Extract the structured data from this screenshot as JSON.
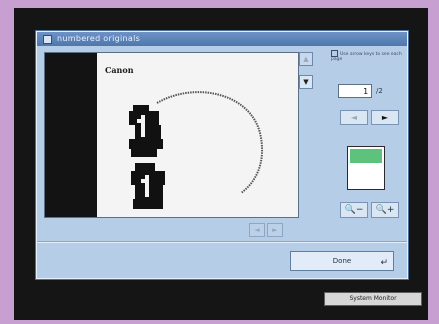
{
  "window": {
    "title": "numbered originals"
  },
  "preview": {
    "logo": "Canon"
  },
  "sidebar": {
    "hint": "Use arrow keys to see each page",
    "page_number": "1",
    "page_total": "/2",
    "prev_label": "◄",
    "next_label": "►",
    "zoom_out_label": "🔍−",
    "zoom_in_label": "🔍+"
  },
  "footer": {
    "done_label": "Done",
    "enter_icon": "↵"
  },
  "taskbar": {
    "system_monitor_label": "System Monitor"
  },
  "colors": {
    "background": "#c79fd0",
    "window": "#b6cde7",
    "titlebar": "#4f77ad",
    "thumbnail_fill": "#5cc27c"
  }
}
